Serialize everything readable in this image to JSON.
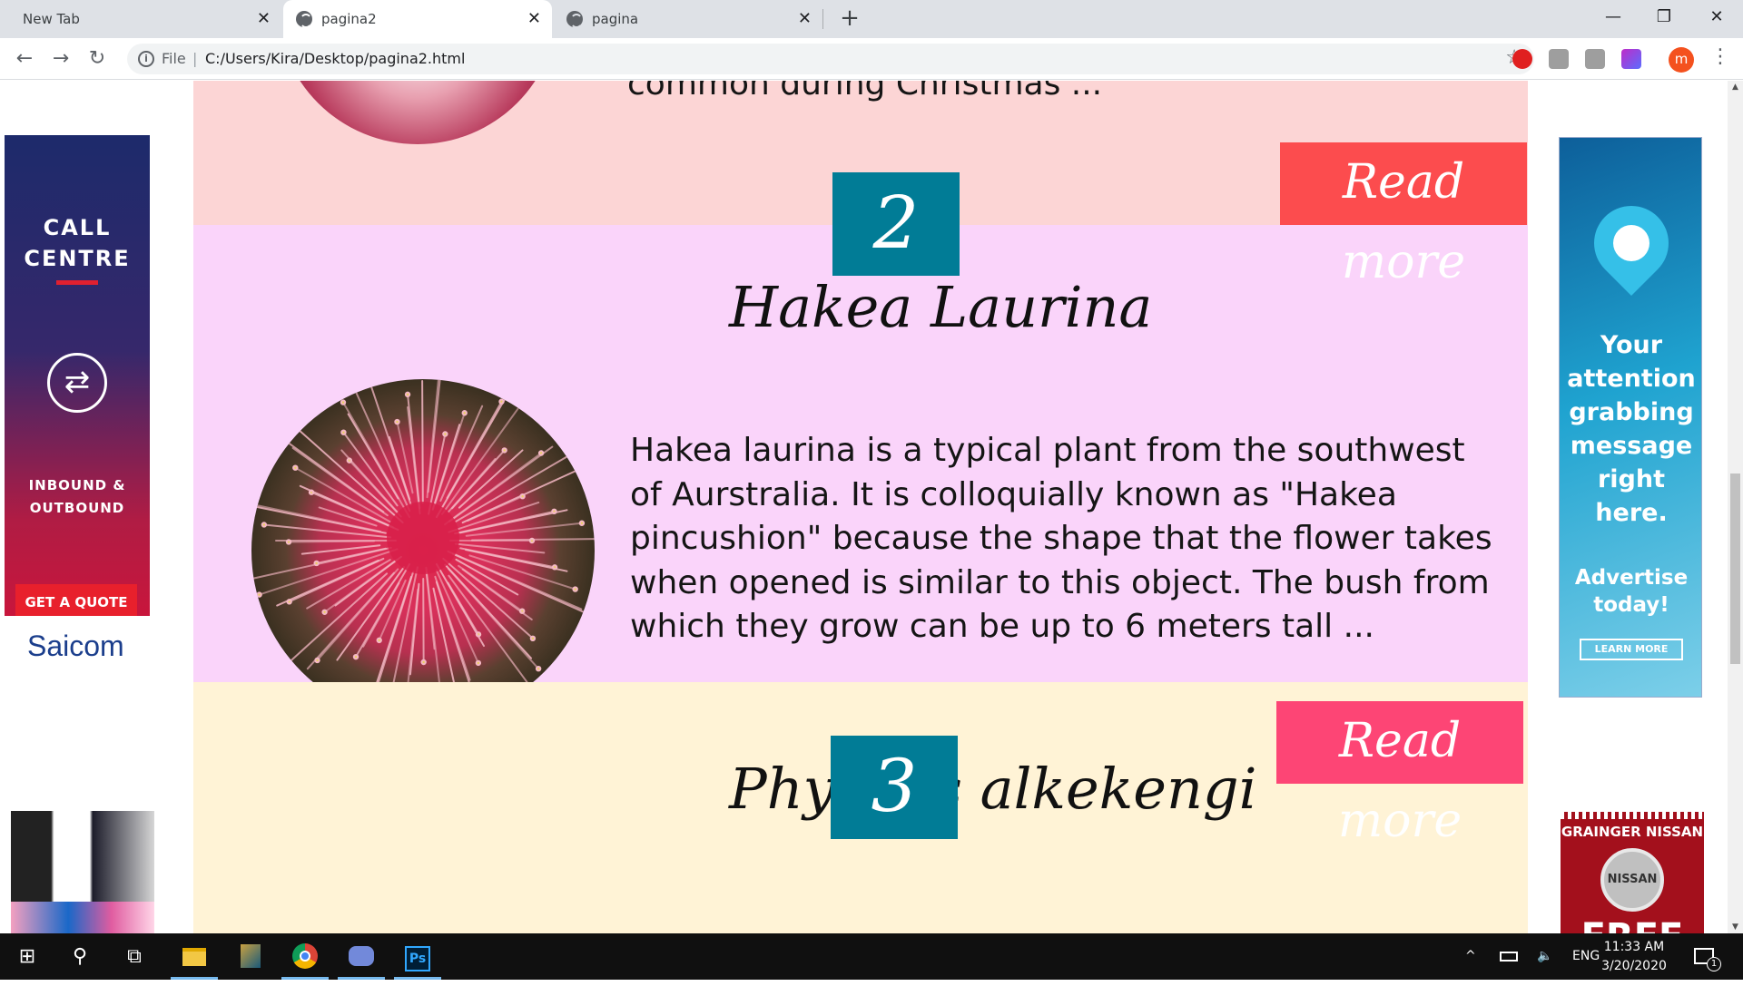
{
  "browser": {
    "tabs": [
      {
        "title": "New Tab",
        "close": "✕"
      },
      {
        "title": "pagina2",
        "close": "✕"
      },
      {
        "title": "pagina",
        "close": "✕"
      }
    ],
    "new_tab": "+",
    "window": {
      "minimize": "—",
      "restore": "❐",
      "close": "✕"
    },
    "nav": {
      "back": "←",
      "forward": "→",
      "reload": "↻"
    },
    "address": {
      "info": "i",
      "protocol": "File",
      "divider": "|",
      "url": "C:/Users/Kira/Desktop/pagina2.html",
      "bookmark": "☆"
    },
    "profile": "m",
    "menu": "⋮"
  },
  "ads": {
    "call_centre": {
      "title": "CALL CENTRE",
      "icon": "⇄",
      "subtitle": "INBOUND & OUTBOUND",
      "button": "GET A QUOTE",
      "brand": "Saicom"
    },
    "attention": {
      "message": "Your attention grabbing message right here.",
      "advertise": "Advertise today!",
      "button": "LEARN MORE"
    },
    "nissan": {
      "dealer": "GRAINGER NISSAN",
      "logo": "NISSAN",
      "promo": "FREE"
    }
  },
  "content": {
    "section1": {
      "text_tail": "common during Christmas ...",
      "read_more": "Read more",
      "read_more_color": "#fc4c4e"
    },
    "section2": {
      "number": "2",
      "title": "Hakea Laurina",
      "text": "Hakea laurina is a typical plant from the southwest of Aurstralia. It is colloquially known as \"Hakea pincushion\" because the shape that the flower takes when opened is similar to this object. The bush from which they grow can be up to 6 meters tall ...",
      "read_more": "Read more",
      "read_more_color": "#fd4575"
    },
    "section3": {
      "number": "3",
      "title": "Physalis alkekengi"
    }
  },
  "colors": {
    "section1_bg": "#fcd5d5",
    "section2_bg": "#fad4fa",
    "section3_bg": "#fff3d6",
    "number_box": "#017c96"
  },
  "taskbar": {
    "start": "⊞",
    "search": "⚲",
    "task_view": "⧉",
    "apps": [
      "file-explorer",
      "league-of-legends",
      "chrome",
      "discord",
      "photoshop"
    ],
    "ps_label": "Ps",
    "tray": {
      "chevron": "^",
      "lang": "ENG",
      "time": "11:33 AM",
      "date": "3/20/2020",
      "notifications": "1"
    }
  }
}
